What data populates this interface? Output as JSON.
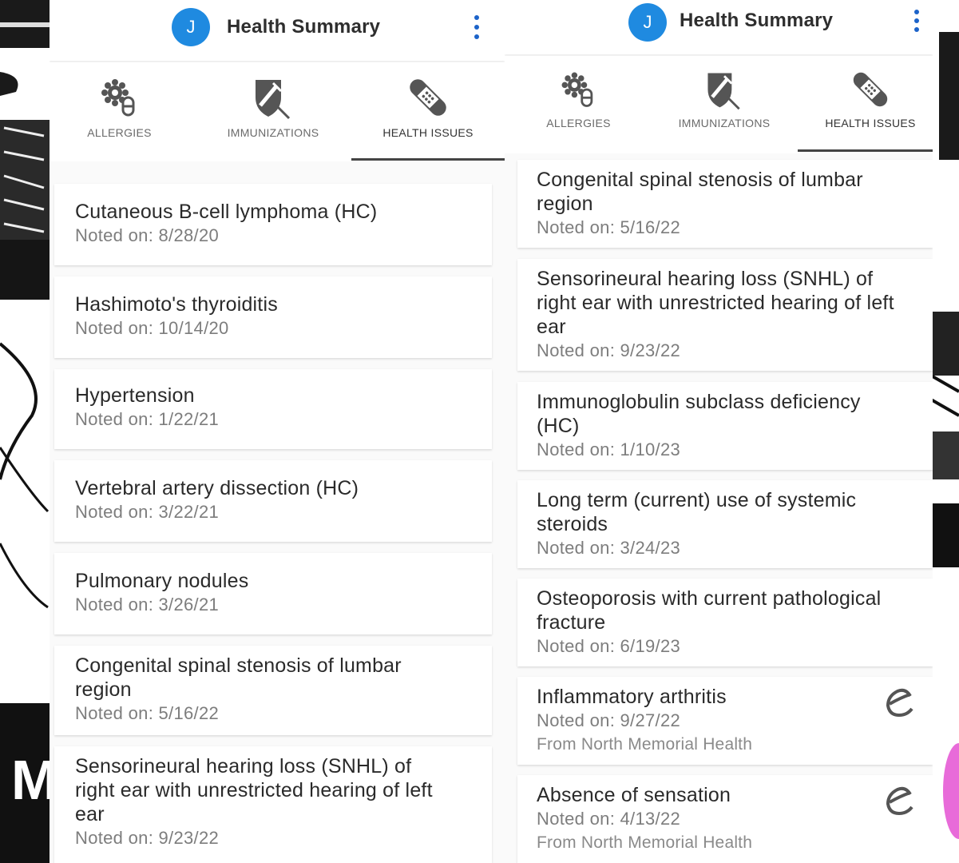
{
  "colors": {
    "accent": "#1f8ae0",
    "kebab": "#1c63c9",
    "indicator": "#444444",
    "card_bg": "#ffffff"
  },
  "screens": [
    {
      "app_bar": {
        "avatar_initial": "J",
        "title": "Health Summary",
        "menu_icon": "more-vert-icon"
      },
      "tabs": [
        {
          "label": "ALLERGIES",
          "icon": "allergies-icon"
        },
        {
          "label": "IMMUNIZATIONS",
          "icon": "syringe-shield-icon"
        },
        {
          "label": "HEALTH ISSUES",
          "icon": "bandage-icon",
          "active": true
        }
      ],
      "issues": [
        {
          "name": [
            "Cutaneous B-cell lymphoma (HC)"
          ],
          "noted": "Noted on: 8/28/20"
        },
        {
          "name": [
            "Hashimoto's thyroiditis"
          ],
          "noted": "Noted on: 10/14/20"
        },
        {
          "name": [
            "Hypertension"
          ],
          "noted": "Noted on: 1/22/21"
        },
        {
          "name": [
            "Vertebral artery dissection (HC)"
          ],
          "noted": "Noted on: 3/22/21"
        },
        {
          "name": [
            "Pulmonary nodules"
          ],
          "noted": "Noted on: 3/26/21"
        },
        {
          "name": [
            "Congenital spinal stenosis of lumbar",
            "region"
          ],
          "noted": "Noted on: 5/16/22"
        },
        {
          "name": [
            "Sensorineural hearing loss (SNHL) of",
            "right ear with unrestricted hearing of left",
            "ear"
          ],
          "noted": "Noted on: 9/23/22"
        }
      ]
    },
    {
      "app_bar": {
        "avatar_initial": "J",
        "title": "Health Summary",
        "menu_icon": "more-vert-icon"
      },
      "tabs": [
        {
          "label": "ALLERGIES",
          "icon": "allergies-icon"
        },
        {
          "label": "IMMUNIZATIONS",
          "icon": "syringe-shield-icon"
        },
        {
          "label": "HEALTH ISSUES",
          "icon": "bandage-icon",
          "active": true
        }
      ],
      "issues": [
        {
          "name": [
            "Congenital spinal stenosis of lumbar",
            "region"
          ],
          "noted": "Noted on: 5/16/22"
        },
        {
          "name": [
            "Sensorineural hearing loss (SNHL) of",
            "right ear with unrestricted hearing of left",
            "ear"
          ],
          "noted": "Noted on: 9/23/22"
        },
        {
          "name": [
            "Immunoglobulin subclass deficiency",
            "(HC)"
          ],
          "noted": "Noted on: 1/10/23"
        },
        {
          "name": [
            "Long term (current) use of systemic",
            "steroids"
          ],
          "noted": "Noted on: 3/24/23"
        },
        {
          "name": [
            "Osteoporosis with current pathological",
            "fracture"
          ],
          "noted": "Noted on: 6/19/23"
        },
        {
          "name": [
            "Inflammatory arthritis"
          ],
          "noted": "Noted on: 9/27/22",
          "source": "From North Memorial Health",
          "badge": "care-everywhere-icon"
        },
        {
          "name": [
            "Absence of sensation"
          ],
          "noted": "Noted on: 4/13/22",
          "source": "From North Memorial Health",
          "badge": "care-everywhere-icon"
        }
      ]
    }
  ]
}
